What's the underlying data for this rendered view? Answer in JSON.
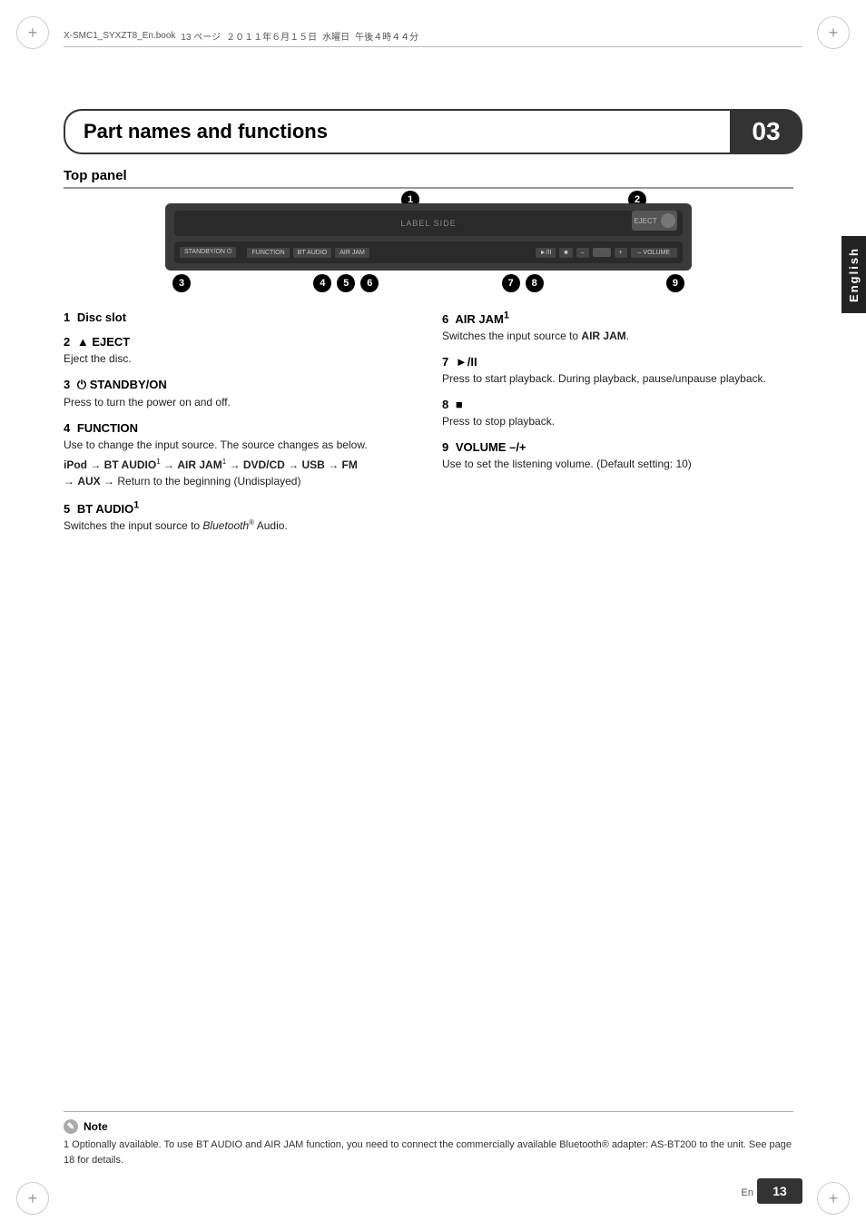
{
  "page": {
    "title": "Part names and functions",
    "chapter_number": "03",
    "page_number": "13",
    "page_en": "En",
    "language_tab": "English"
  },
  "file_info": {
    "filename": "X-SMC1_SYXZT8_En.book",
    "page_ref": "13 ページ",
    "date": "２０１１年６月１５日",
    "day": "水曜日",
    "time": "午後４時４４分"
  },
  "top_panel": {
    "section_title": "Top panel",
    "device": {
      "slot_label": "LABEL SIDE",
      "eject_label": "EJECT"
    },
    "callouts": [
      {
        "num": "1",
        "label": "1"
      },
      {
        "num": "2",
        "label": "2"
      },
      {
        "num": "3",
        "label": "3"
      },
      {
        "num": "4",
        "label": "4"
      },
      {
        "num": "5",
        "label": "5"
      },
      {
        "num": "6",
        "label": "6"
      },
      {
        "num": "7",
        "label": "7"
      },
      {
        "num": "8",
        "label": "8"
      },
      {
        "num": "9",
        "label": "9"
      }
    ],
    "bottom_labels": [
      "3",
      "4",
      "5",
      "6",
      "7",
      "8",
      "9"
    ]
  },
  "items": {
    "left": [
      {
        "num": "1",
        "title": "Disc slot",
        "description": ""
      },
      {
        "num": "2",
        "title": "▲ EJECT",
        "description": "Eject the disc."
      },
      {
        "num": "3",
        "title": "⏻ STANDBY/ON",
        "description": "Press to turn the power on and off."
      },
      {
        "num": "4",
        "title": "FUNCTION",
        "description": "Use to change the input source. The source changes as below.",
        "sequence": "iPod → BT AUDIO¹ → AIR JAM¹ → DVD/CD → USB → FM → AUX → Return to the beginning (Undisplayed)"
      },
      {
        "num": "5",
        "title": "BT AUDIO¹",
        "description": "Switches the input source to Bluetooth® Audio."
      }
    ],
    "right": [
      {
        "num": "6",
        "title": "AIR JAM¹",
        "description": "Switches the input source to AIR JAM."
      },
      {
        "num": "7",
        "title": "►/II",
        "description": "Press to start playback. During playback, pause/unpause playback."
      },
      {
        "num": "8",
        "title": "■",
        "description": "Press to stop playback."
      },
      {
        "num": "9",
        "title": "VOLUME –/+",
        "description": "Use to set the listening volume. (Default setting: 10)"
      }
    ]
  },
  "note": {
    "label": "Note",
    "footnote": "1  Optionally available. To use BT AUDIO and AIR JAM function, you need to connect the commercially available Bluetooth® adapter: AS-BT200 to the unit. See page 18 for details."
  }
}
